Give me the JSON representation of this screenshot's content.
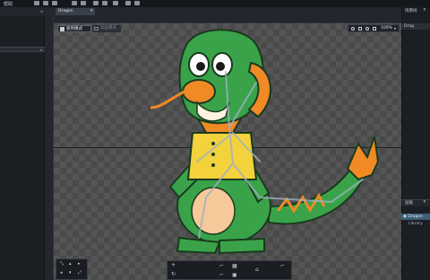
{
  "menubar": {
    "label": "帮助"
  },
  "document_tab": {
    "title": "Dragon",
    "close_glyph": "✕"
  },
  "canvas_toolbar": {
    "mode_a": "姿势模式",
    "mode_b": "动画模式",
    "zoom": "100%",
    "zoom_caret": "▾"
  },
  "right_panel": {
    "top_title": "场景树",
    "top_close": "✕",
    "top_item": "Drag",
    "bottom_title": "层级",
    "bottom_close": "✕",
    "item_root": "Dragon",
    "item_child": "Library"
  },
  "left_panel": {
    "row_caret": "▾"
  },
  "icons": {
    "pin": "pin-icon",
    "close": "close-icon",
    "visibility": "eye-icon"
  },
  "colors": {
    "dragon_green": "#3aa34a",
    "dragon_orange": "#f08a24",
    "vest_yellow": "#f3d23c",
    "selection_blue": "#3d5f7a"
  }
}
